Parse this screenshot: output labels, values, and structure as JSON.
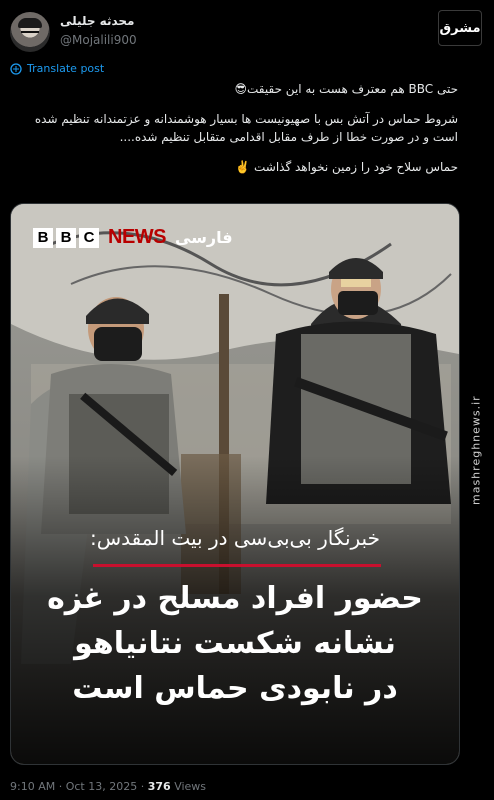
{
  "author": {
    "name": "محدثه جلیلی",
    "handle": "@Mojalili900"
  },
  "source_badge": {
    "text": "مشرق"
  },
  "translate_label": "Translate post",
  "tweet": {
    "line1": "حتی BBC هم معترف هست به این حقیقت😎",
    "line2": "شروط حماس در آتش بس با صهیونیست ها  بسیار هوشمندانه  و عزتمندانه تنظیم شده است و در صورت خطا از طرف مقابل اقدامی متقابل تنظیم شده....",
    "line3": "حماس سلاح خود را زمین نخواهد گذاشت ✌️"
  },
  "media": {
    "bbc_letters": [
      "B",
      "B",
      "C"
    ],
    "bbc_news": "NEWS",
    "bbc_lang": "فارسی",
    "caption": "خبرنگار بی‌بی‌سی در بیت المقدس:",
    "headline_lines": [
      "حضور افراد مسلح در غزه",
      "نشانه شکست نتانیاهو",
      "در نابودی حماس است"
    ]
  },
  "watermark": "mashreghnews.ir",
  "footer": {
    "time": "9:10 AM",
    "date": "Oct 13, 2025",
    "views_count": "376",
    "views_label": "Views"
  },
  "colors": {
    "link": "#1d9bf0",
    "muted": "#71767b",
    "bbc_red": "#b80000",
    "caption_rule": "#c8102e"
  }
}
